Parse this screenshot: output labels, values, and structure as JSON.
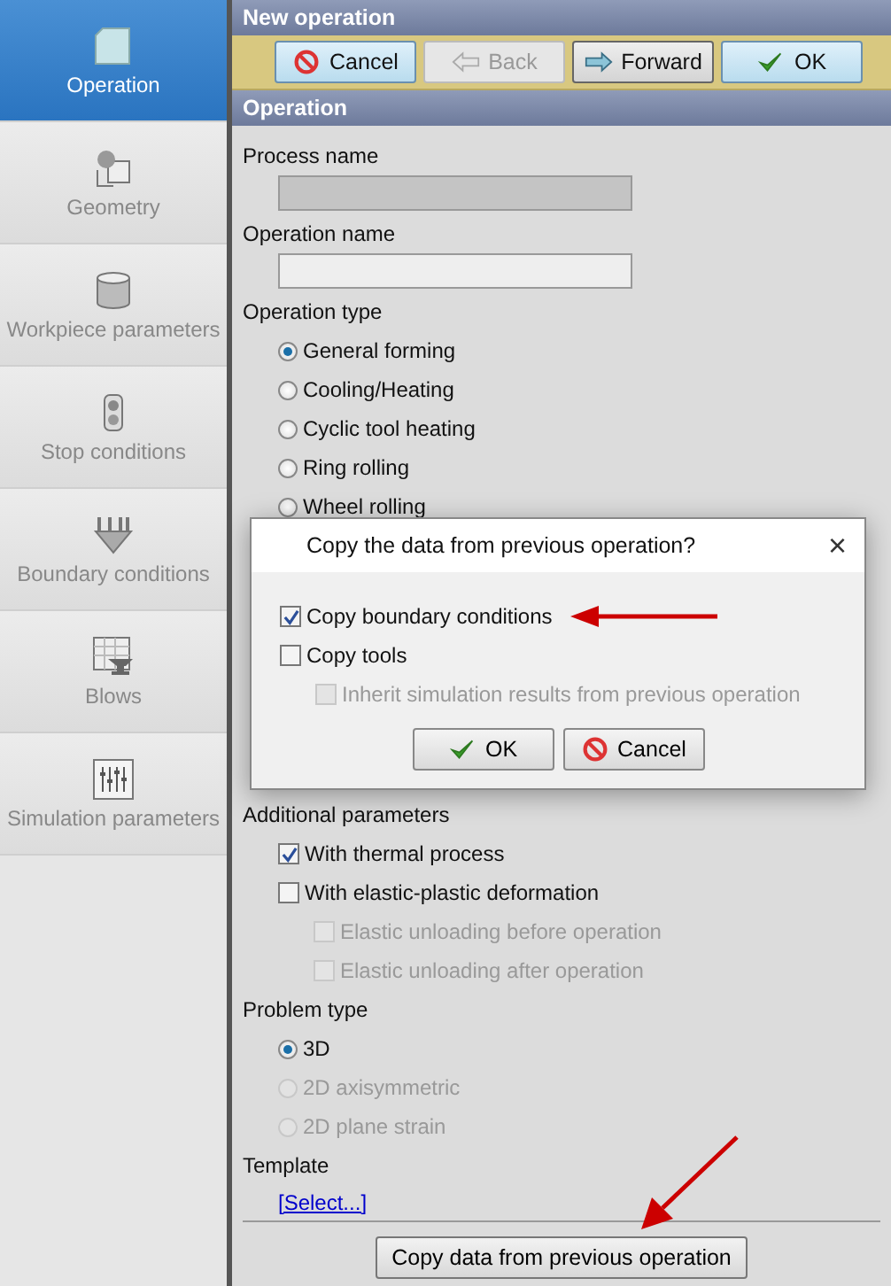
{
  "sidebar": [
    {
      "label": "Operation",
      "kind": "operation",
      "selected": true
    },
    {
      "label": "Geometry",
      "kind": "geometry",
      "selected": false
    },
    {
      "label": "Workpiece parameters",
      "kind": "workpiece",
      "selected": false
    },
    {
      "label": "Stop conditions",
      "kind": "stop",
      "selected": false
    },
    {
      "label": "Boundary conditions",
      "kind": "boundary",
      "selected": false
    },
    {
      "label": "Blows",
      "kind": "blows",
      "selected": false
    },
    {
      "label": "Simulation parameters",
      "kind": "simulation",
      "selected": false
    }
  ],
  "panel_title": "New operation",
  "toolbar": [
    {
      "label": "Cancel",
      "kind": "cancel",
      "disabled": false
    },
    {
      "label": "Back",
      "kind": "back",
      "disabled": true
    },
    {
      "label": "Forward",
      "kind": "forward",
      "disabled": false
    },
    {
      "label": "OK",
      "kind": "ok",
      "disabled": false
    }
  ],
  "section_title": "Operation",
  "fields": [
    {
      "label": "Process name",
      "disabled": true
    },
    {
      "label": "Operation name",
      "disabled": false
    }
  ],
  "operation_type": {
    "label": "Operation type",
    "options": [
      {
        "label": "General forming",
        "selected": true
      },
      {
        "label": "Cooling/Heating",
        "selected": false
      },
      {
        "label": "Cyclic tool heating",
        "selected": false
      },
      {
        "label": "Ring rolling",
        "selected": false
      },
      {
        "label": "Wheel rolling",
        "selected": false
      }
    ]
  },
  "additional_parameters": {
    "label": "Additional parameters",
    "options": [
      {
        "label": "With thermal process",
        "checked": true,
        "disabled": false
      },
      {
        "label": "With elastic-plastic deformation",
        "checked": false,
        "disabled": false,
        "children": [
          {
            "label": "Elastic unloading before operation",
            "checked": false,
            "disabled": true
          },
          {
            "label": "Elastic unloading after operation",
            "checked": false,
            "disabled": true
          }
        ]
      }
    ]
  },
  "problem_type": {
    "label": "Problem type",
    "options": [
      {
        "label": "3D",
        "selected": true,
        "disabled": false
      },
      {
        "label": "2D axisymmetric",
        "selected": false,
        "disabled": true
      },
      {
        "label": "2D plane strain",
        "selected": false,
        "disabled": true
      }
    ]
  },
  "template": {
    "label": "Template",
    "link": "[Select...]"
  },
  "footer_button": "Copy data from previous operation",
  "dialog": {
    "title": "Copy the data from previous operation?",
    "close": "×",
    "options": [
      {
        "label": "Copy boundary conditions",
        "checked": true,
        "disabled": false
      },
      {
        "label": "Copy tools",
        "checked": false,
        "disabled": false,
        "children": [
          {
            "label": "Inherit simulation results from previous operation",
            "checked": false,
            "disabled": true
          }
        ]
      }
    ],
    "buttons": [
      {
        "label": "OK",
        "kind": "ok"
      },
      {
        "label": "Cancel",
        "kind": "cancel"
      }
    ]
  }
}
